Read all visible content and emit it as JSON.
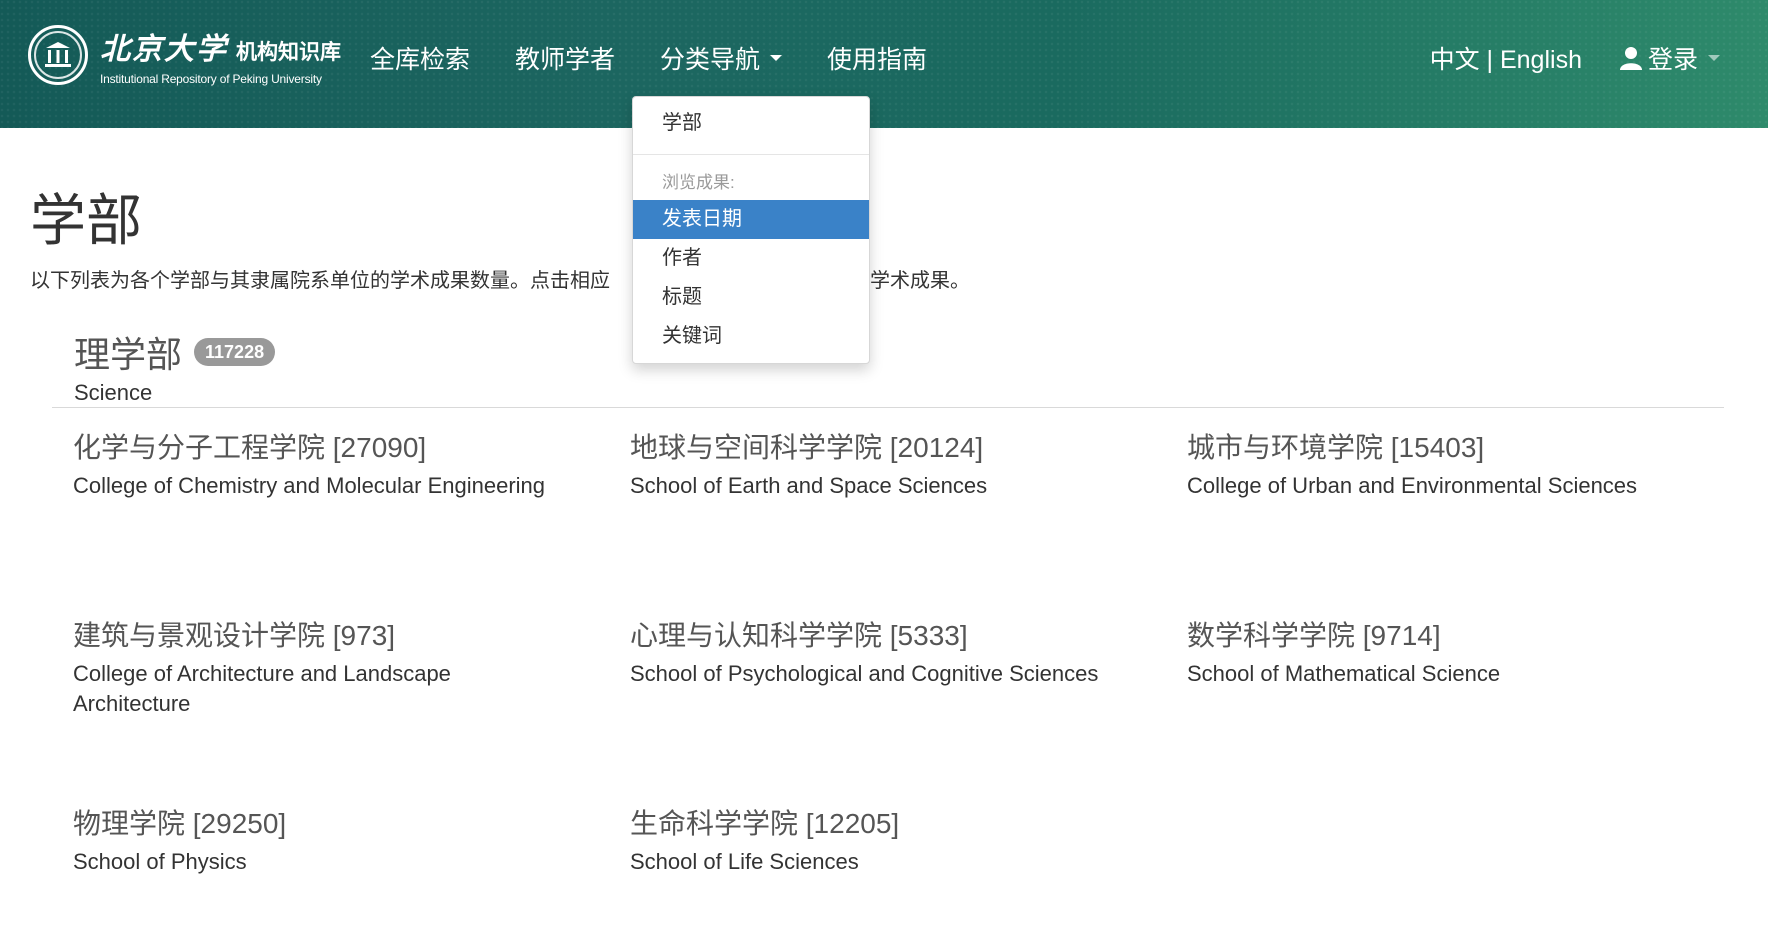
{
  "navbar": {
    "brand": {
      "cn_name": "北京大学",
      "cn_sub": "机构知识库",
      "en_name": "Institutional Repository of Peking University"
    },
    "links": [
      {
        "label": "全库检索"
      },
      {
        "label": "教师学者"
      },
      {
        "label": "分类导航",
        "has_dropdown": true
      },
      {
        "label": "使用指南"
      }
    ],
    "language_toggle": "中文 | English",
    "login_label": "登录"
  },
  "dropdown": {
    "top_item": "学部",
    "browse_header": "浏览成果:",
    "items": [
      "发表日期",
      "作者",
      "标题",
      "关键词"
    ],
    "active_item": "发表日期"
  },
  "page": {
    "title": "学部",
    "intro_left": "以下列表为各个学部与其隶属院系单位的学术成果数量。点击相应",
    "intro_right": "的学术成果。"
  },
  "section": {
    "title_cn": "理学部",
    "count": "117228",
    "title_en": "Science"
  },
  "schools": [
    {
      "cn": "化学与分子工程学院 [27090]",
      "en": "College of Chemistry and Molecular Engineering"
    },
    {
      "cn": "地球与空间科学学院 [20124]",
      "en": "School of Earth and Space Sciences"
    },
    {
      "cn": "城市与环境学院 [15403]",
      "en": "College of Urban and Environmental Sciences"
    },
    {
      "cn": "建筑与景观设计学院 [973]",
      "en": "College of Architecture and Landscape Architecture"
    },
    {
      "cn": "心理与认知科学学院 [5333]",
      "en": "School of Psychological and Cognitive Sciences"
    },
    {
      "cn": "数学科学学院 [9714]",
      "en": "School of Mathematical Science"
    },
    {
      "cn": "物理学院 [29250]",
      "en": "School of Physics"
    },
    {
      "cn": "生命科学学院 [12205]",
      "en": "School of Life Sciences"
    }
  ],
  "colors": {
    "navbar": "#1c6660",
    "dropdown_active": "#3a82c8",
    "badge": "#999999"
  }
}
